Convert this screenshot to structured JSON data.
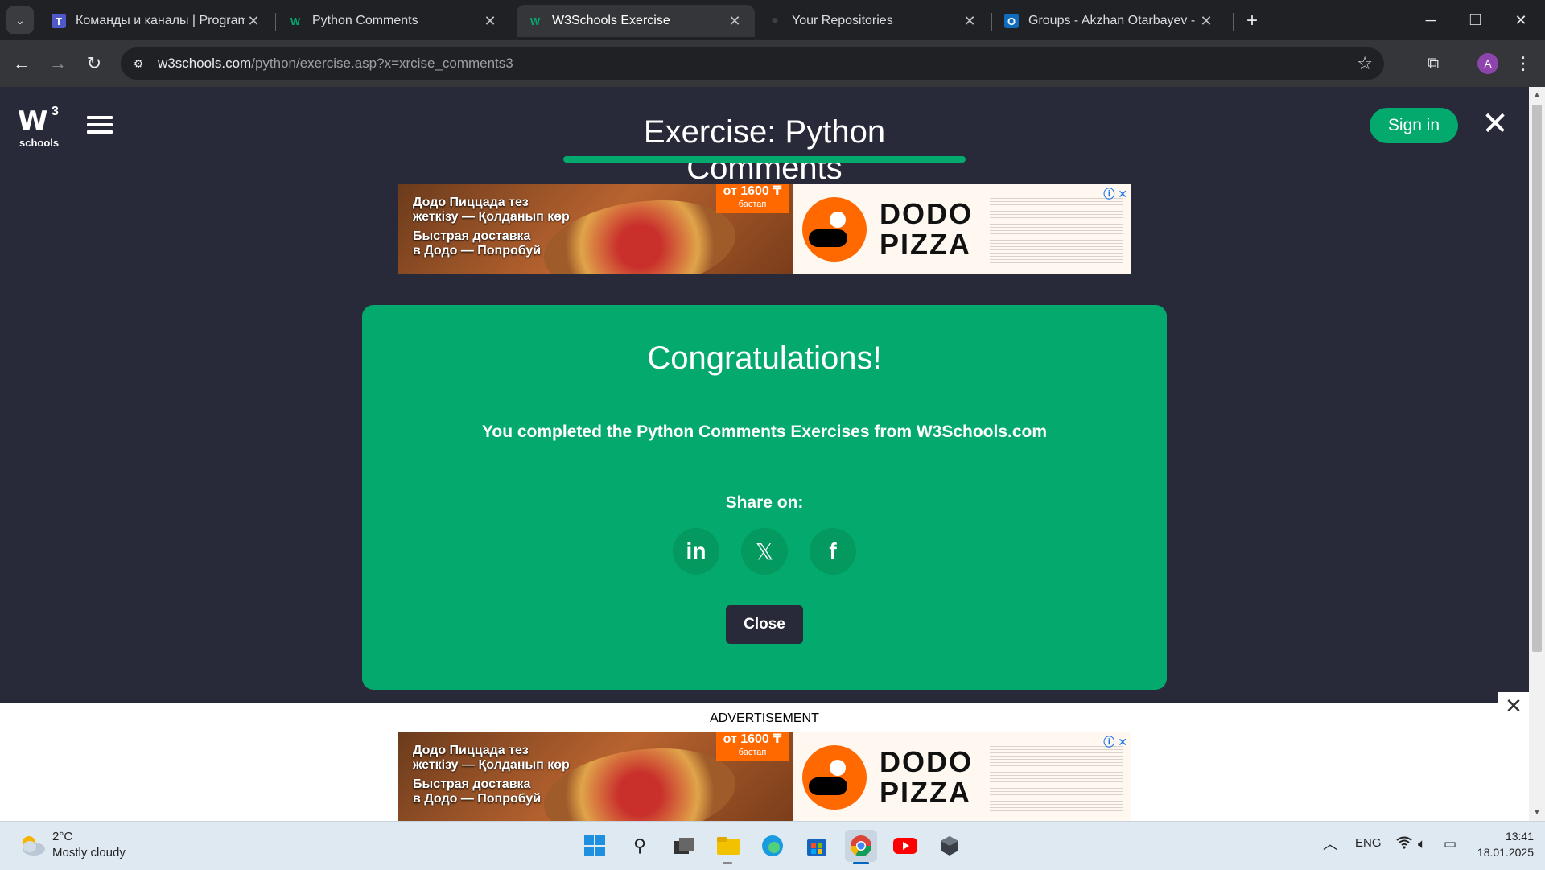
{
  "browser": {
    "tabs": [
      {
        "title": "Команды и каналы | Programm",
        "favicon": "teams-icon"
      },
      {
        "title": "Python Comments",
        "favicon": "w3schools-icon"
      },
      {
        "title": "W3Schools Exercise",
        "favicon": "w3schools-icon",
        "active": true
      },
      {
        "title": "Your Repositories",
        "favicon": "github-icon"
      },
      {
        "title": "Groups - Akzhan Otarbayev - O",
        "favicon": "outlook-icon"
      }
    ],
    "url_host": "w3schools.com",
    "url_path": "/python/exercise.asp?x=xrcise_comments3",
    "profile_initial": "A"
  },
  "header": {
    "logo_mark": "W",
    "logo_sup": "3",
    "logo_sub": "schools",
    "title": "Exercise: Python Comments",
    "signin_label": "Sign in"
  },
  "ad": {
    "line1": "Додо Пиццада тез",
    "line2": "жеткізу — Қолданып көр",
    "line3": "Быстрая доставка",
    "line4": "в Додо — Попробуй",
    "price": "от 1600 ₸",
    "price_sub": "бастап",
    "brand_line1": "DODO",
    "brand_line2": "PIZZA"
  },
  "modal": {
    "heading": "Congratulations!",
    "message": "You completed the Python Comments Exercises from W3Schools.com",
    "share_label": "Share on:",
    "social": [
      {
        "name": "linkedin",
        "glyph": "in"
      },
      {
        "name": "x",
        "glyph": "𝕏"
      },
      {
        "name": "facebook",
        "glyph": "f"
      }
    ],
    "close_label": "Close"
  },
  "ad_footer": {
    "label": "ADVERTISEMENT"
  },
  "taskbar": {
    "temperature": "2°C",
    "weather": "Mostly cloudy",
    "language": "ENG",
    "time": "13:41",
    "date": "18.01.2025"
  },
  "colors": {
    "w3_green": "#04aa6d",
    "page_bg": "#282a3a",
    "dodo_orange": "#ff6900"
  }
}
